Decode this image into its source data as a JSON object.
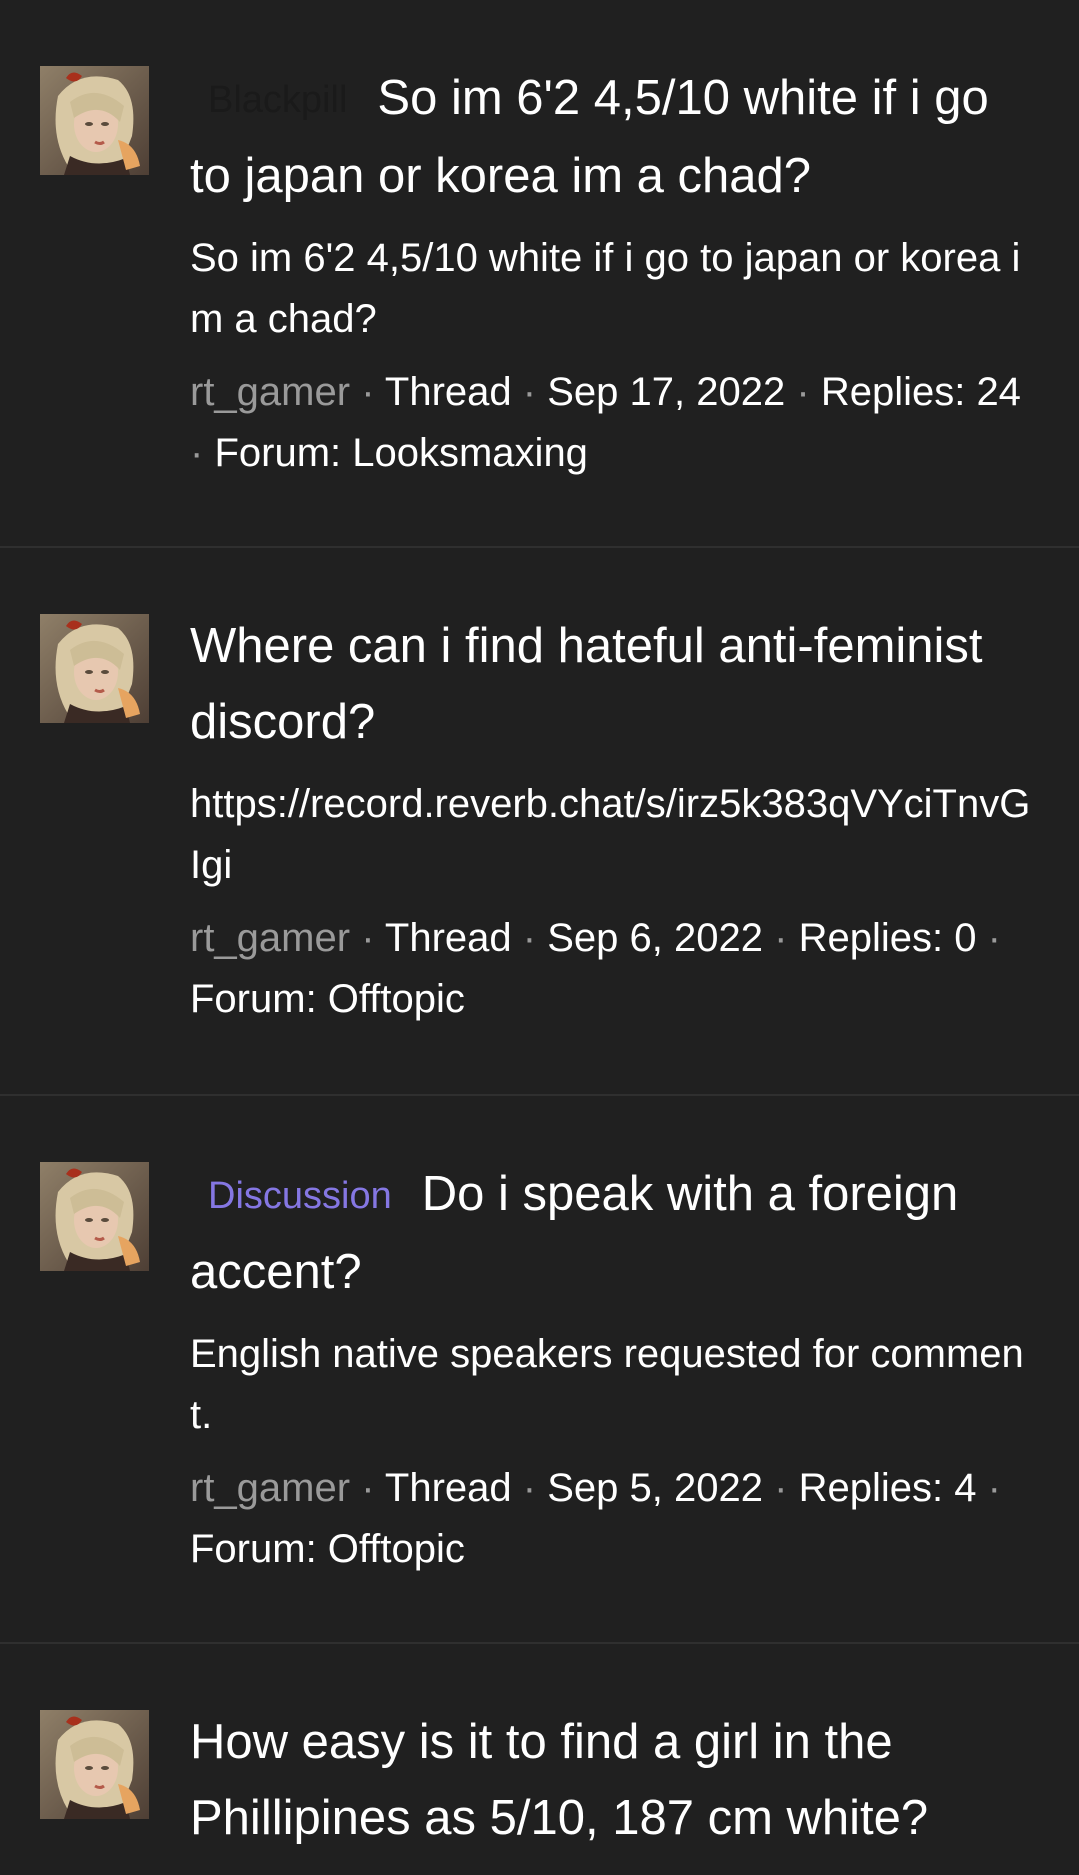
{
  "colors": {
    "background": "#202020",
    "divider": "#2f2f2f",
    "author": "#9a9a9a",
    "discussion_prefix": "#8577e3",
    "blackpill_prefix": "#1a1a1a"
  },
  "separator": "·",
  "threads": [
    {
      "prefix": "Blackpill",
      "title": "So im 6'2 4,5/10 white if i go to japan or korea im a chad?",
      "snippet": "So im 6'2 4,5/10 white if i go to japan or korea im a chad?",
      "author": "rt_gamer",
      "type": "Thread",
      "date": "Sep 17, 2022",
      "replies": "Replies: 24",
      "forum": "Forum: Looksmaxing",
      "avatar_icon": "avatar-portrait-icon"
    },
    {
      "prefix": "",
      "title": "Where can i find hateful anti-feminist discord?",
      "snippet": "https://record.reverb.chat/s/irz5k383qVYciTnvGIgi",
      "author": "rt_gamer",
      "type": "Thread",
      "date": "Sep 6, 2022",
      "replies": "Replies: 0",
      "forum": "Forum: Offtopic",
      "avatar_icon": "avatar-portrait-icon"
    },
    {
      "prefix": "Discussion",
      "title": "Do i speak with a foreign accent?",
      "snippet": "English native speakers requested for comment.",
      "author": "rt_gamer",
      "type": "Thread",
      "date": "Sep 5, 2022",
      "replies": "Replies: 4",
      "forum": "Forum: Offtopic",
      "avatar_icon": "avatar-portrait-icon"
    },
    {
      "prefix": "",
      "title": "How easy is it to find a girl in the Phillipines as 5/10, 187 cm white?",
      "avatar_icon": "avatar-portrait-icon"
    }
  ]
}
